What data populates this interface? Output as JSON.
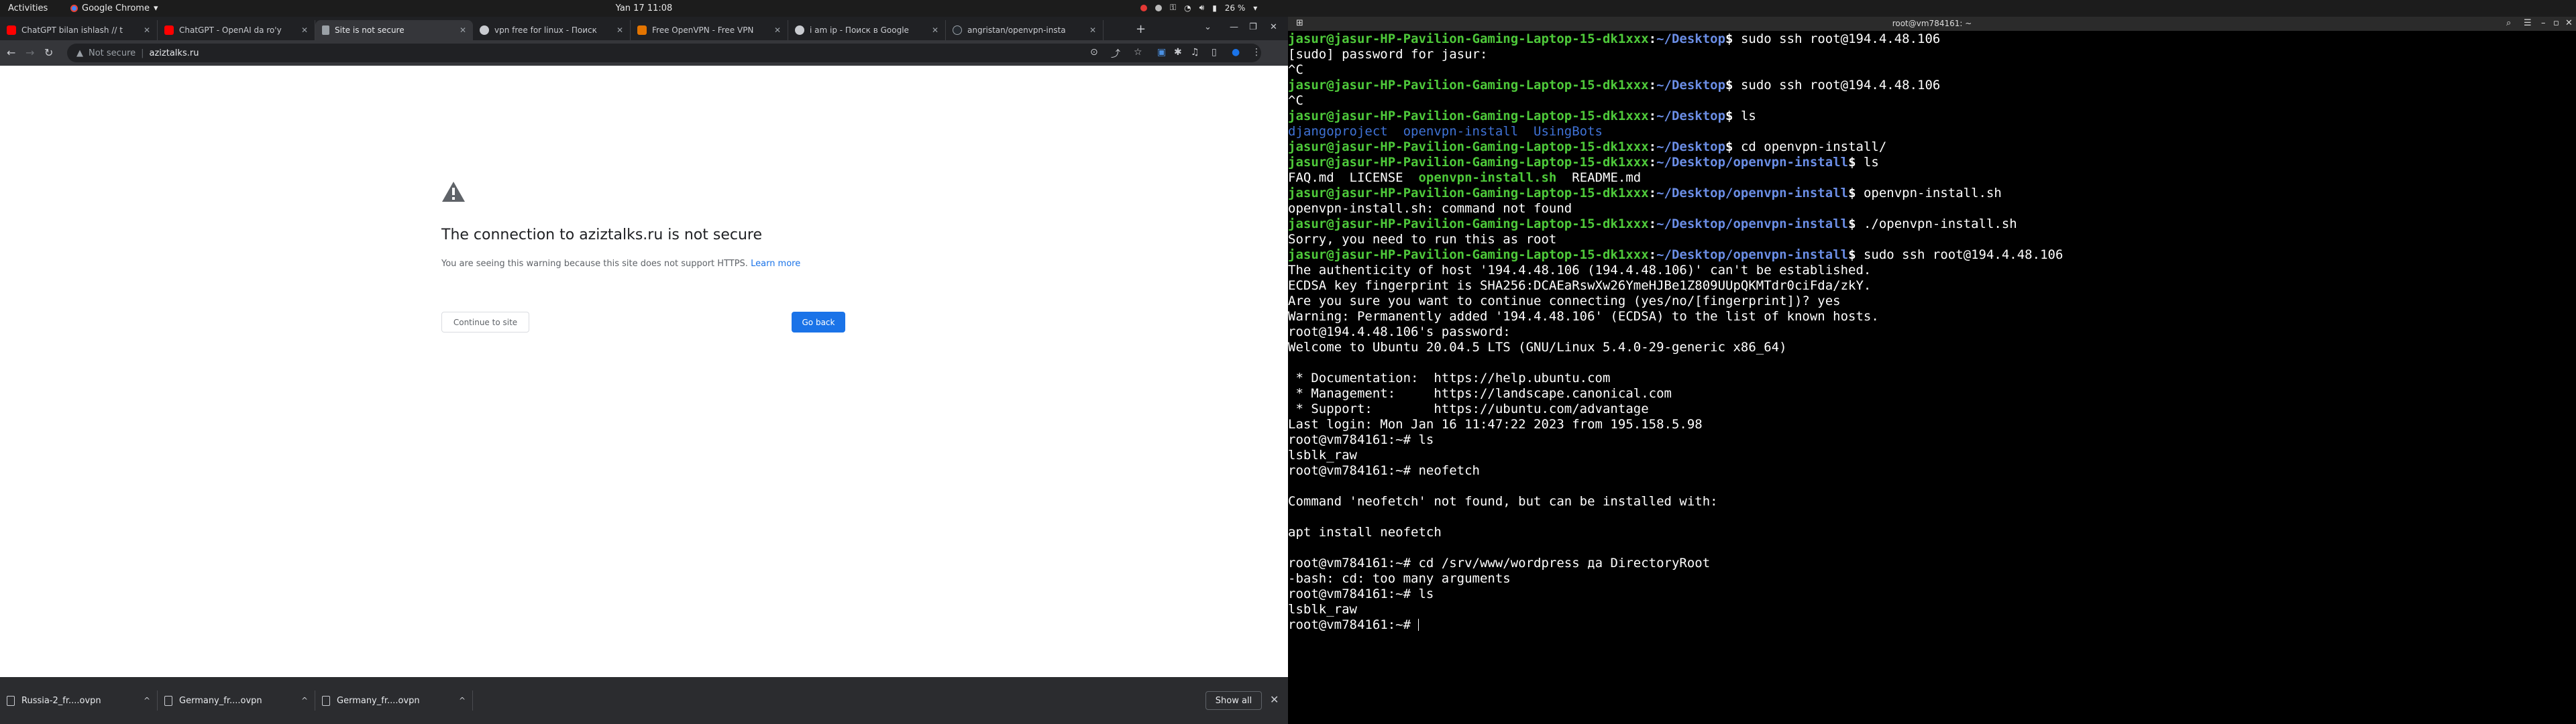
{
  "topbar": {
    "activities": "Activities",
    "app": "Google Chrome",
    "clock": "Yan 17  11:08",
    "battery": "26 %"
  },
  "browser": {
    "tabs": [
      {
        "label": "ChatGPT bilan ishlash // t",
        "favicon_color": "#ff0000"
      },
      {
        "label": "ChatGPT - OpenAI da ro'y",
        "favicon_color": "#ff0000"
      },
      {
        "label": "Site is not secure",
        "favicon_color": "#9aa0a6"
      },
      {
        "label": "vpn free for linux - Поиск",
        "favicon_color": "#c9cbd0"
      },
      {
        "label": "Free OpenVPN - Free VPN",
        "favicon_color": "#e37400"
      },
      {
        "label": "i am ip - Поиск в Google",
        "favicon_color": "#c9cbd0"
      },
      {
        "label": "angristan/openvpn-insta",
        "favicon_color": "#24292f"
      }
    ],
    "omnibox": {
      "security": "Not secure",
      "url": "aziztalks.ru"
    }
  },
  "interstitial": {
    "heading": "The connection to aziztalks.ru is not secure",
    "description": "You are seeing this warning because this site does not support HTTPS.",
    "learn_more": "Learn more",
    "continue_label": "Continue to site",
    "back_label": "Go back"
  },
  "downloads": {
    "items": [
      {
        "name": "Russia-2_fr....ovpn"
      },
      {
        "name": "Germany_fr....ovpn"
      },
      {
        "name": "Germany_fr....ovpn"
      }
    ],
    "show_all": "Show all"
  },
  "terminal": {
    "title": "root@vm784161: ~",
    "prompt_user": "jasur@jasur-HP-Pavilion-Gaming-Laptop-15-dk1xxx",
    "root_prompt": "root@vm784161:~# ",
    "lines": [
      {
        "t": "p",
        "path": "~/Desktop",
        "cmd": "sudo ssh root@194.4.48.106"
      },
      {
        "t": "o",
        "text": "[sudo] password for jasur:"
      },
      {
        "t": "o",
        "text": "^C"
      },
      {
        "t": "p",
        "path": "~/Desktop",
        "cmd": "sudo ssh root@194.4.48.106"
      },
      {
        "t": "o",
        "text": "^C"
      },
      {
        "t": "p",
        "path": "~/Desktop",
        "cmd": "ls"
      },
      {
        "t": "d",
        "text": "djangoproject  openvpn-install  UsingBots"
      },
      {
        "t": "p",
        "path": "~/Desktop",
        "cmd": "cd openvpn-install/"
      },
      {
        "t": "p",
        "path": "~/Desktop/openvpn-install",
        "cmd": "ls"
      },
      {
        "t": "m",
        "a": "FAQ.md  LICENSE  ",
        "b": "openvpn-install.sh",
        "c": "  README.md"
      },
      {
        "t": "p",
        "path": "~/Desktop/openvpn-install",
        "cmd": "openvpn-install.sh"
      },
      {
        "t": "o",
        "text": "openvpn-install.sh: command not found"
      },
      {
        "t": "p",
        "path": "~/Desktop/openvpn-install",
        "cmd": "./openvpn-install.sh"
      },
      {
        "t": "o",
        "text": "Sorry, you need to run this as root"
      },
      {
        "t": "p",
        "path": "~/Desktop/openvpn-install",
        "cmd": "sudo ssh root@194.4.48.106"
      },
      {
        "t": "o",
        "text": "The authenticity of host '194.4.48.106 (194.4.48.106)' can't be established."
      },
      {
        "t": "o",
        "text": "ECDSA key fingerprint is SHA256:DCAEaRswXw26YmeHJBe1Z809UUpQKMTdr0ciFda/zkY."
      },
      {
        "t": "o",
        "text": "Are you sure you want to continue connecting (yes/no/[fingerprint])? yes"
      },
      {
        "t": "o",
        "text": "Warning: Permanently added '194.4.48.106' (ECDSA) to the list of known hosts."
      },
      {
        "t": "o",
        "text": "root@194.4.48.106's password:"
      },
      {
        "t": "o",
        "text": "Welcome to Ubuntu 20.04.5 LTS (GNU/Linux 5.4.0-29-generic x86_64)"
      },
      {
        "t": "o",
        "text": ""
      },
      {
        "t": "o",
        "text": " * Documentation:  https://help.ubuntu.com"
      },
      {
        "t": "o",
        "text": " * Management:     https://landscape.canonical.com"
      },
      {
        "t": "o",
        "text": " * Support:        https://ubuntu.com/advantage"
      },
      {
        "t": "o",
        "text": "Last login: Mon Jan 16 11:47:22 2023 from 195.158.5.98"
      },
      {
        "t": "r",
        "cmd": "ls"
      },
      {
        "t": "o",
        "text": "lsblk_raw"
      },
      {
        "t": "r",
        "cmd": "neofetch"
      },
      {
        "t": "o",
        "text": ""
      },
      {
        "t": "o",
        "text": "Command 'neofetch' not found, but can be installed with:"
      },
      {
        "t": "o",
        "text": ""
      },
      {
        "t": "o",
        "text": "apt install neofetch"
      },
      {
        "t": "o",
        "text": ""
      },
      {
        "t": "r",
        "cmd": "cd /srv/www/wordpress да DirectoryRoot"
      },
      {
        "t": "o",
        "text": "-bash: cd: too many arguments"
      },
      {
        "t": "r",
        "cmd": "ls"
      },
      {
        "t": "o",
        "text": "lsblk_raw"
      },
      {
        "t": "r",
        "cmd": "",
        "cursor": true
      }
    ]
  }
}
